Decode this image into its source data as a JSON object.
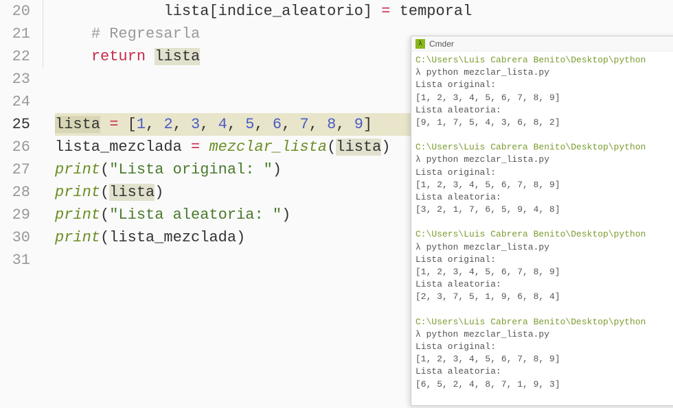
{
  "editor": {
    "lines": [
      {
        "num": "20",
        "highlighted": false,
        "indent": "            ",
        "tokens": [
          {
            "cls": "tk-variable",
            "t": "lista"
          },
          {
            "cls": "tk-bracket",
            "t": "["
          },
          {
            "cls": "tk-variable",
            "t": "indice_aleatorio"
          },
          {
            "cls": "tk-bracket",
            "t": "]"
          },
          {
            "cls": "",
            "t": " "
          },
          {
            "cls": "tk-operator",
            "t": "="
          },
          {
            "cls": "",
            "t": " "
          },
          {
            "cls": "tk-variable",
            "t": "temporal"
          }
        ]
      },
      {
        "num": "21",
        "highlighted": false,
        "indent": "    ",
        "tokens": [
          {
            "cls": "tk-comment",
            "t": "# Regresarla"
          }
        ]
      },
      {
        "num": "22",
        "highlighted": false,
        "indent": "    ",
        "tokens": [
          {
            "cls": "tk-keyword",
            "t": "return"
          },
          {
            "cls": "",
            "t": " "
          },
          {
            "cls": "tk-highlighted-var",
            "t": "lista"
          }
        ]
      },
      {
        "num": "23",
        "highlighted": false,
        "indent": "",
        "tokens": []
      },
      {
        "num": "24",
        "highlighted": false,
        "indent": "",
        "tokens": []
      },
      {
        "num": "25",
        "highlighted": true,
        "indent": "",
        "tokens": [
          {
            "cls": "tk-highlighted-var",
            "t": "lista"
          },
          {
            "cls": "",
            "t": " "
          },
          {
            "cls": "tk-operator",
            "t": "="
          },
          {
            "cls": "",
            "t": " "
          },
          {
            "cls": "tk-bracket",
            "t": "["
          },
          {
            "cls": "tk-number",
            "t": "1"
          },
          {
            "cls": "",
            "t": ", "
          },
          {
            "cls": "tk-number",
            "t": "2"
          },
          {
            "cls": "",
            "t": ", "
          },
          {
            "cls": "tk-number",
            "t": "3"
          },
          {
            "cls": "",
            "t": ", "
          },
          {
            "cls": "tk-number",
            "t": "4"
          },
          {
            "cls": "",
            "t": ", "
          },
          {
            "cls": "tk-number",
            "t": "5"
          },
          {
            "cls": "",
            "t": ", "
          },
          {
            "cls": "tk-number",
            "t": "6"
          },
          {
            "cls": "",
            "t": ", "
          },
          {
            "cls": "tk-number",
            "t": "7"
          },
          {
            "cls": "",
            "t": ", "
          },
          {
            "cls": "tk-number",
            "t": "8"
          },
          {
            "cls": "",
            "t": ", "
          },
          {
            "cls": "tk-number",
            "t": "9"
          },
          {
            "cls": "tk-bracket",
            "t": "]"
          }
        ]
      },
      {
        "num": "26",
        "highlighted": false,
        "indent": "",
        "tokens": [
          {
            "cls": "tk-variable",
            "t": "lista_mezclada"
          },
          {
            "cls": "",
            "t": " "
          },
          {
            "cls": "tk-operator",
            "t": "="
          },
          {
            "cls": "",
            "t": " "
          },
          {
            "cls": "tk-function",
            "t": "mezclar_lista"
          },
          {
            "cls": "tk-bracket",
            "t": "("
          },
          {
            "cls": "tk-highlighted-var",
            "t": "lista"
          },
          {
            "cls": "tk-bracket",
            "t": ")"
          }
        ]
      },
      {
        "num": "27",
        "highlighted": false,
        "indent": "",
        "tokens": [
          {
            "cls": "tk-function",
            "t": "print"
          },
          {
            "cls": "tk-bracket",
            "t": "("
          },
          {
            "cls": "tk-string",
            "t": "\"Lista original: \""
          },
          {
            "cls": "tk-bracket",
            "t": ")"
          }
        ]
      },
      {
        "num": "28",
        "highlighted": false,
        "indent": "",
        "tokens": [
          {
            "cls": "tk-function",
            "t": "print"
          },
          {
            "cls": "tk-bracket",
            "t": "("
          },
          {
            "cls": "tk-highlighted-var",
            "t": "lista"
          },
          {
            "cls": "tk-bracket",
            "t": ")"
          }
        ]
      },
      {
        "num": "29",
        "highlighted": false,
        "indent": "",
        "tokens": [
          {
            "cls": "tk-function",
            "t": "print"
          },
          {
            "cls": "tk-bracket",
            "t": "("
          },
          {
            "cls": "tk-string",
            "t": "\"Lista aleatoria: \""
          },
          {
            "cls": "tk-bracket",
            "t": ")"
          }
        ]
      },
      {
        "num": "30",
        "highlighted": false,
        "indent": "",
        "tokens": [
          {
            "cls": "tk-function",
            "t": "print"
          },
          {
            "cls": "tk-bracket",
            "t": "("
          },
          {
            "cls": "tk-variable",
            "t": "lista_mezclada"
          },
          {
            "cls": "tk-bracket",
            "t": ")"
          }
        ]
      },
      {
        "num": "31",
        "highlighted": false,
        "indent": "",
        "tokens": []
      }
    ],
    "active_line": "25",
    "gutter_until_line": "22"
  },
  "terminal": {
    "title": "Cmder",
    "icon_glyph": "λ",
    "path": "C:\\Users\\Luis Cabrera Benito\\Desktop\\python",
    "prompt": "λ ",
    "command": "python mezclar_lista.py",
    "runs": [
      {
        "out": [
          "Lista original:",
          "[1, 2, 3, 4, 5, 6, 7, 8, 9]",
          "Lista aleatoria:",
          "[9, 1, 7, 5, 4, 3, 6, 8, 2]"
        ]
      },
      {
        "out": [
          "Lista original:",
          "[1, 2, 3, 4, 5, 6, 7, 8, 9]",
          "Lista aleatoria:",
          "[3, 2, 1, 7, 6, 5, 9, 4, 8]"
        ]
      },
      {
        "out": [
          "Lista original:",
          "[1, 2, 3, 4, 5, 6, 7, 8, 9]",
          "Lista aleatoria:",
          "[2, 3, 7, 5, 1, 9, 6, 8, 4]"
        ]
      },
      {
        "out": [
          "Lista original:",
          "[1, 2, 3, 4, 5, 6, 7, 8, 9]",
          "Lista aleatoria:",
          "[6, 5, 2, 4, 8, 7, 1, 9, 3]"
        ]
      }
    ]
  }
}
